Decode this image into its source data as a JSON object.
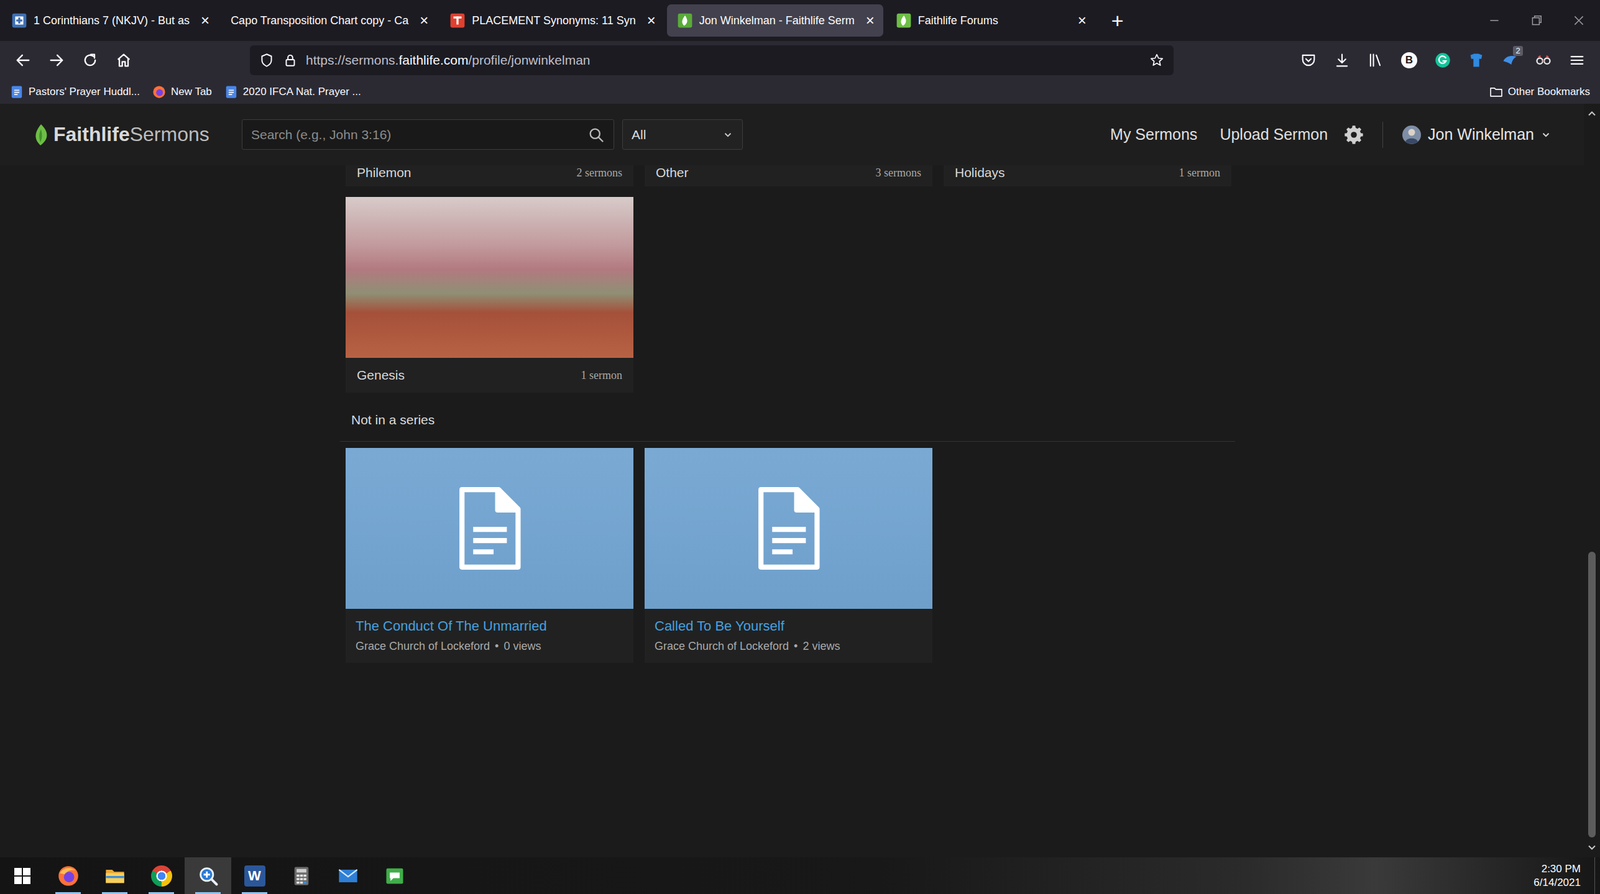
{
  "browser": {
    "tabs": [
      {
        "label": "1 Corinthians 7 (NKJV) - But as",
        "kind": "bible",
        "selected": false
      },
      {
        "label": "Capo Transposition Chart copy - Ca",
        "kind": "none",
        "selected": false
      },
      {
        "label": "PLACEMENT Synonyms: 11 Syn",
        "kind": "thesaurus",
        "selected": false
      },
      {
        "label": "Jon Winkelman - Faithlife Serm",
        "kind": "faithlife",
        "selected": true
      },
      {
        "label": "Faithlife Forums",
        "kind": "forums",
        "selected": false
      }
    ],
    "tab_close": "×",
    "new_tab": "+",
    "url": {
      "prefix": "https://sermons.",
      "domain": "faithlife.com",
      "path": "/profile/jonwinkelman"
    },
    "extension_letter": "B",
    "extension_badge": "2",
    "bookmarks": [
      {
        "label": "Pastors' Prayer Huddl...",
        "kind": "doc"
      },
      {
        "label": "New Tab",
        "kind": "firefox"
      },
      {
        "label": "2020 IFCA Nat. Prayer ...",
        "kind": "doc"
      }
    ],
    "other_bookmarks": "Other Bookmarks"
  },
  "site": {
    "brand": "Faithlife",
    "product": "Sermons",
    "search_placeholder": "Search (e.g., John 3:16)",
    "filter": "All",
    "nav": [
      {
        "label": "My Sermons"
      },
      {
        "label": "Upload Sermon"
      }
    ],
    "user": "Jon Winkelman"
  },
  "series_row_partial": [
    {
      "name": "Philemon",
      "count": "2 sermons"
    },
    {
      "name": "Other",
      "count": "3 sermons"
    },
    {
      "name": "Holidays",
      "count": "1 sermon"
    }
  ],
  "series": [
    {
      "name": "Genesis",
      "count": "1 sermon"
    }
  ],
  "section_title": "Not in a series",
  "meta_separator": "•",
  "sermons": [
    {
      "title": "The Conduct Of The Unmarried",
      "church": "Grace Church of Lockeford",
      "views": "0 views"
    },
    {
      "title": "Called To Be Yourself",
      "church": "Grace Church of Lockeford",
      "views": "2 views"
    }
  ],
  "scrollbar": {
    "level": 1,
    "thumb": 0.4
  },
  "taskbar": {
    "apps": [
      {
        "kind": "firefox",
        "running": true,
        "active": false
      },
      {
        "kind": "explorer",
        "running": true,
        "active": false
      },
      {
        "kind": "chrome",
        "running": true,
        "active": false
      },
      {
        "kind": "magnifier",
        "running": true,
        "active": true
      },
      {
        "kind": "word",
        "label": "W",
        "running": true,
        "active": false
      },
      {
        "kind": "calculator",
        "running": false,
        "active": false
      },
      {
        "kind": "mail",
        "running": false,
        "active": false
      },
      {
        "kind": "messages",
        "running": false,
        "active": false
      }
    ],
    "time": "2:30 PM",
    "date": "6/14/2021"
  }
}
